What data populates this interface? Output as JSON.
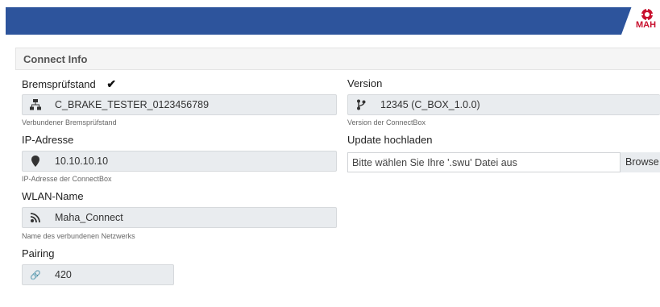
{
  "header": {
    "brand_text": "MAH",
    "brand_color": "#c8102e",
    "bar_color": "#2d549c"
  },
  "panel": {
    "title": "Connect Info"
  },
  "brake_tester": {
    "label": "Bremsprüfstand",
    "status_icon": "check-icon",
    "value": "C_BRAKE_TESTER_0123456789",
    "icon": "network-icon",
    "help": "Verbundener Bremsprüfstand"
  },
  "ip": {
    "label": "IP-Adresse",
    "value": "10.10.10.10",
    "icon": "location-pin-icon",
    "help": "IP-Adresse der ConnectBox"
  },
  "wlan": {
    "label": "WLAN-Name",
    "value": "Maha_Connect",
    "icon": "wifi-signal-icon",
    "help": "Name des verbundenen Netzwerks"
  },
  "pairing": {
    "label": "Pairing",
    "value": "420",
    "icon": "link-icon"
  },
  "version": {
    "label": "Version",
    "value": "12345 (C_BOX_1.0.0)",
    "icon": "git-branch-icon",
    "help": "Version der ConnectBox"
  },
  "update": {
    "label": "Update hochladen",
    "placeholder": "Bitte wählen Sie Ihre '.swu' Datei aus",
    "browse_label": "Browse"
  }
}
